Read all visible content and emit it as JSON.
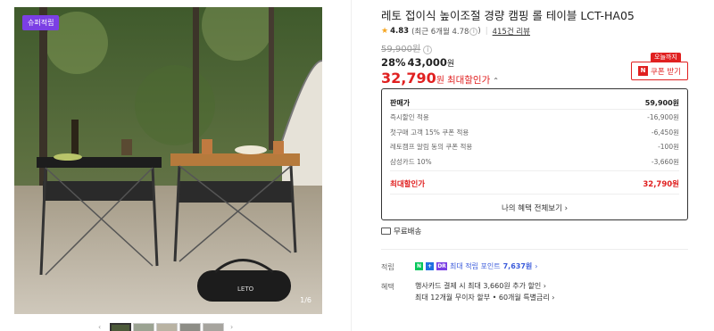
{
  "gallery": {
    "badge": "슈퍼적립",
    "counter": "1/6"
  },
  "product": {
    "title": "레토 접이식 높이조절 경량 캠핑 롤 테이블 LCT-HA05",
    "rating": "4.83",
    "rating_detail": "(최근 6개월 4.78",
    "reviews": "415건 리뷰",
    "original_price": "59,900원",
    "discount_rate": "28%",
    "sale_price": "43,000",
    "sale_unit": "원",
    "max_price": "32,790",
    "max_unit": "원",
    "max_label": "최대할인가",
    "coupon_tag": "오늘까지",
    "coupon_label": "쿠폰 받기"
  },
  "benefits": {
    "head": {
      "label": "판매가",
      "value": "59,900원"
    },
    "rows": [
      {
        "label": "즉시할인 적용",
        "value": "-16,900원"
      },
      {
        "label": "첫구매 고객 15% 쿠폰 적용",
        "value": "-6,450원"
      },
      {
        "label": "레토캠프 알림 동의 쿠폰 적용",
        "value": "-100원"
      },
      {
        "label": "삼성카드 10%",
        "value": "-3,660원"
      }
    ],
    "total": {
      "label": "최대할인가",
      "value": "32,790원"
    },
    "all_link": "나의 혜택 전체보기"
  },
  "shipping": "무료배송",
  "points": {
    "label": "적립",
    "text": "최대 적립 포인트",
    "amount": "7,637원"
  },
  "card_benefit": {
    "label": "혜택",
    "line1": "행사카드 결제 시 최대 3,660원 추가 할인",
    "line2": "최대 12개월 무이자 할부 • 60개월 특별금리"
  }
}
